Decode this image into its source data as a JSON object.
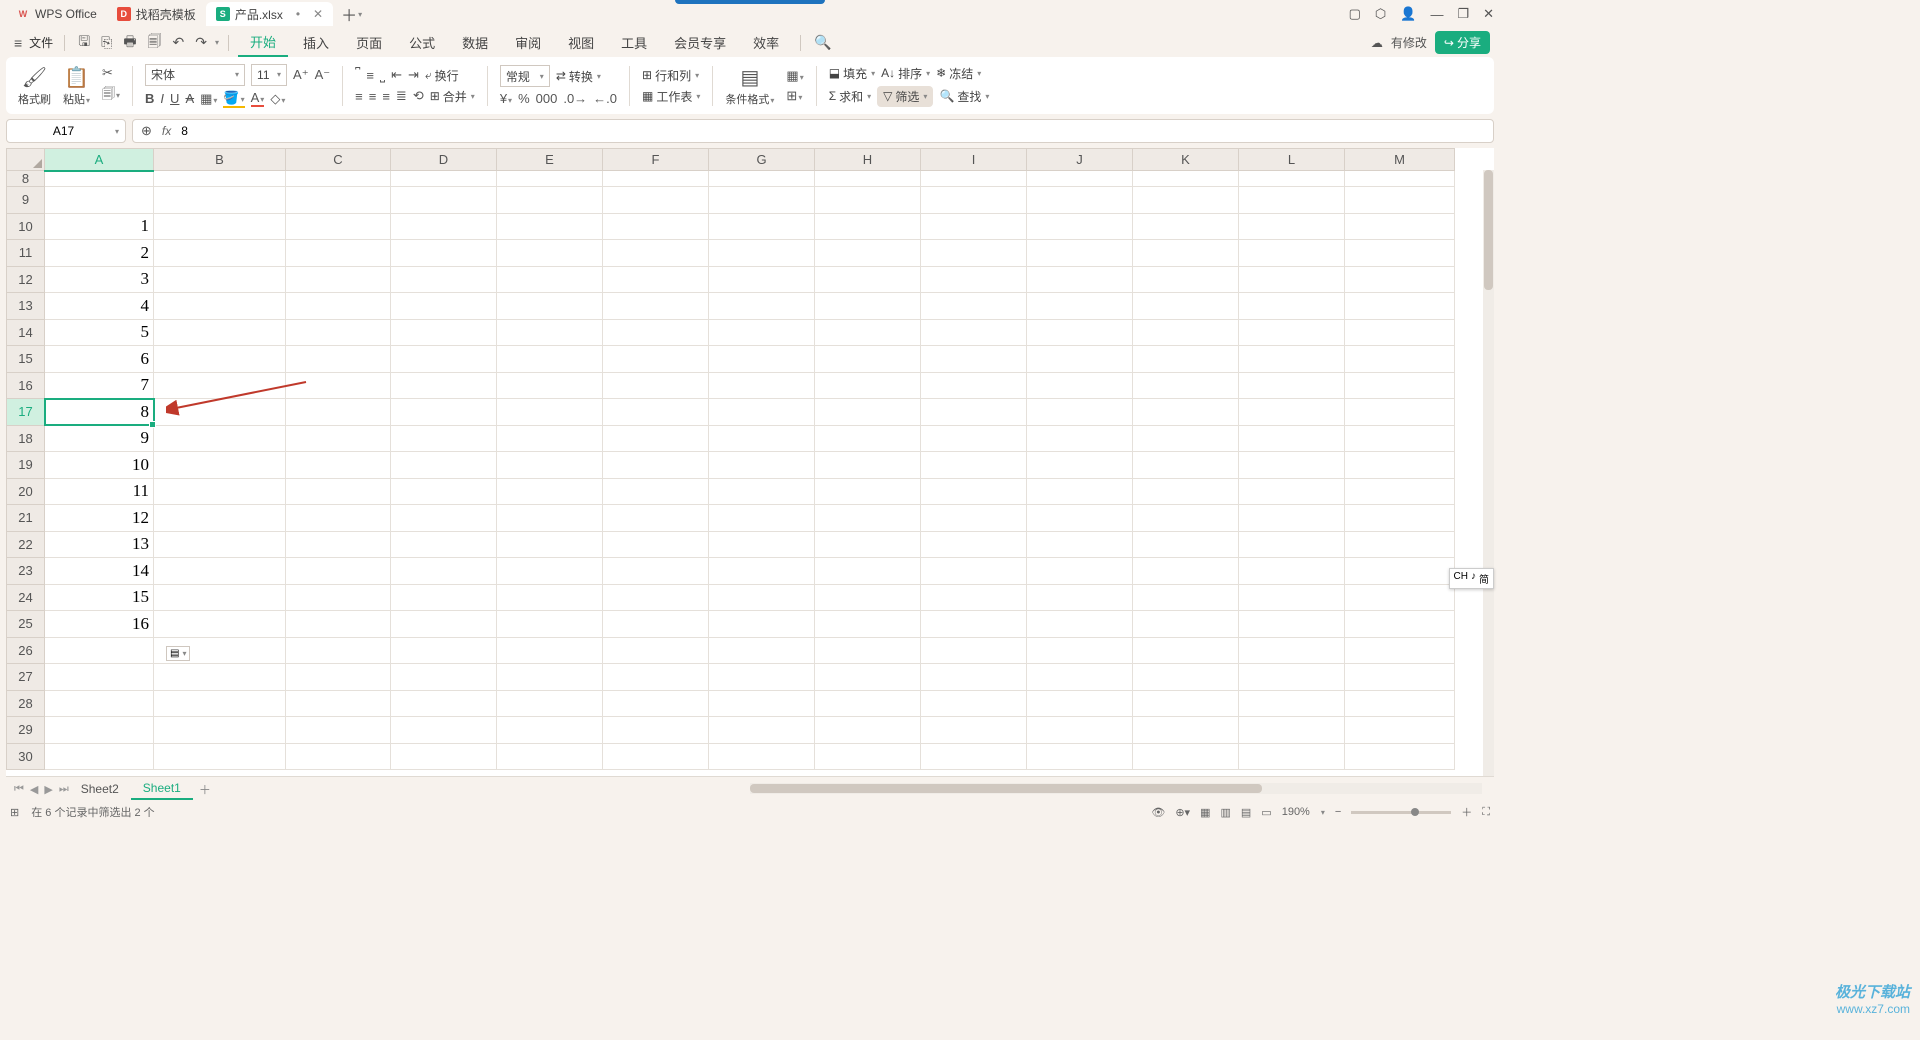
{
  "title": {
    "tabs": [
      {
        "icon": "wps",
        "label": "WPS Office"
      },
      {
        "icon": "tpl",
        "label": "找稻壳模板"
      },
      {
        "icon": "xls",
        "label": "产品.xlsx",
        "dirty": "•",
        "active": true
      }
    ]
  },
  "menubar": {
    "file": "文件",
    "items": [
      "开始",
      "插入",
      "页面",
      "公式",
      "数据",
      "审阅",
      "视图",
      "工具",
      "会员专享",
      "效率"
    ],
    "active": "开始",
    "cloud_status": "有修改",
    "share": "分享"
  },
  "ribbon": {
    "format_brush": "格式刷",
    "paste": "粘贴",
    "font_name": "宋体",
    "font_size": "11",
    "wrap": "换行",
    "merge": "合并",
    "number_format": "常规",
    "convert": "转换",
    "rowcols": "行和列",
    "worksheet": "工作表",
    "cond_format": "条件格式",
    "fill": "填充",
    "sort": "排序",
    "freeze": "冻结",
    "sum": "求和",
    "filter": "筛选",
    "find": "查找"
  },
  "namebox": {
    "cell": "A17"
  },
  "formula": {
    "value": "8"
  },
  "grid": {
    "columns": [
      "A",
      "B",
      "C",
      "D",
      "E",
      "F",
      "G",
      "H",
      "I",
      "J",
      "K",
      "L",
      "M"
    ],
    "rows": [
      "8",
      "9",
      "10",
      "11",
      "12",
      "13",
      "14",
      "15",
      "16",
      "17",
      "18",
      "19",
      "20",
      "21",
      "22",
      "23",
      "24",
      "25",
      "26",
      "27",
      "28",
      "29",
      "30"
    ],
    "colA": {
      "10": "1",
      "11": "2",
      "12": "3",
      "13": "4",
      "14": "5",
      "15": "6",
      "16": "7",
      "17": "8",
      "18": "9",
      "19": "10",
      "20": "11",
      "21": "12",
      "22": "13",
      "23": "14",
      "24": "15",
      "25": "16"
    },
    "selected_row": "17",
    "selected_col": "A"
  },
  "sheets": {
    "tabs": [
      "Sheet2",
      "Sheet1"
    ],
    "active": "Sheet1"
  },
  "statusbar": {
    "filter_status": "在 6 个记录中筛选出 2 个",
    "zoom": "190%"
  },
  "ime": {
    "lang": "CH",
    "mode": "简"
  },
  "watermark": {
    "brand": "极光下载站",
    "url": "www.xz7.com"
  }
}
